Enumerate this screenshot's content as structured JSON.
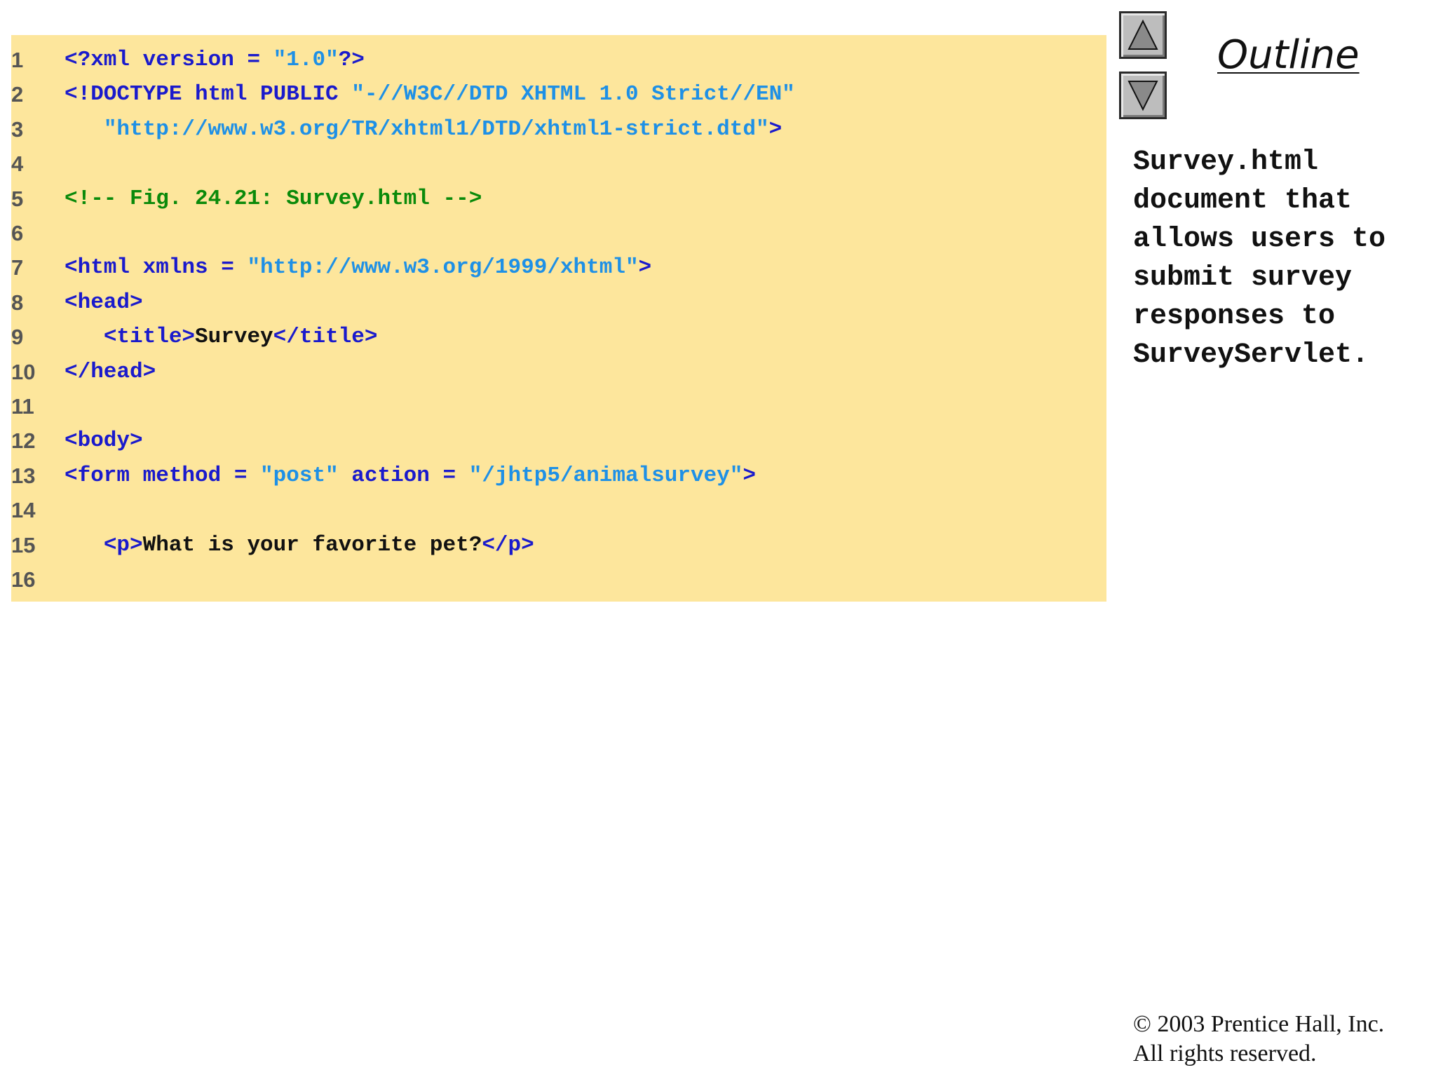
{
  "code_lines": [
    {
      "num": "1",
      "tokens": [
        {
          "t": "<?xml version = ",
          "c": "tag"
        },
        {
          "t": "\"1.0\"",
          "c": "str"
        },
        {
          "t": "?>",
          "c": "tag"
        }
      ]
    },
    {
      "num": "2",
      "tokens": [
        {
          "t": "<!DOCTYPE html PUBLIC ",
          "c": "tag"
        },
        {
          "t": "\"-//W3C//DTD XHTML 1.0 Strict//EN\"",
          "c": "str"
        }
      ]
    },
    {
      "num": "3",
      "tokens": [
        {
          "t": "   ",
          "c": "txt"
        },
        {
          "t": "\"http://www.w3.org/TR/xhtml1/DTD/xhtml1-strict.dtd\"",
          "c": "str"
        },
        {
          "t": ">",
          "c": "tag"
        }
      ]
    },
    {
      "num": "4",
      "tokens": []
    },
    {
      "num": "5",
      "tokens": [
        {
          "t": "<!-- Fig. 24.21: Survey.html -->",
          "c": "cmt"
        }
      ]
    },
    {
      "num": "6",
      "tokens": []
    },
    {
      "num": "7",
      "tokens": [
        {
          "t": "<html xmlns = ",
          "c": "tag"
        },
        {
          "t": "\"http://www.w3.org/1999/xhtml\"",
          "c": "str"
        },
        {
          "t": ">",
          "c": "tag"
        }
      ]
    },
    {
      "num": "8",
      "tokens": [
        {
          "t": "<head>",
          "c": "tag"
        }
      ]
    },
    {
      "num": "9",
      "tokens": [
        {
          "t": "   ",
          "c": "txt"
        },
        {
          "t": "<title>",
          "c": "tag"
        },
        {
          "t": "Survey",
          "c": "txt"
        },
        {
          "t": "</title>",
          "c": "tag"
        }
      ]
    },
    {
      "num": "10",
      "tokens": [
        {
          "t": "</head>",
          "c": "tag"
        }
      ]
    },
    {
      "num": "11",
      "tokens": []
    },
    {
      "num": "12",
      "tokens": [
        {
          "t": "<body>",
          "c": "tag"
        }
      ]
    },
    {
      "num": "13",
      "tokens": [
        {
          "t": "<form method = ",
          "c": "tag"
        },
        {
          "t": "\"post\"",
          "c": "str"
        },
        {
          "t": " action = ",
          "c": "tag"
        },
        {
          "t": "\"/jhtp5/animalsurvey\"",
          "c": "str"
        },
        {
          "t": ">",
          "c": "tag"
        }
      ]
    },
    {
      "num": "14",
      "tokens": []
    },
    {
      "num": "15",
      "tokens": [
        {
          "t": "   ",
          "c": "txt"
        },
        {
          "t": "<p>",
          "c": "tag"
        },
        {
          "t": "What is your favorite pet?",
          "c": "txt"
        },
        {
          "t": "</p>",
          "c": "tag"
        }
      ]
    },
    {
      "num": "16",
      "tokens": []
    }
  ],
  "outline": {
    "title": "Outline"
  },
  "description": {
    "lines": [
      "Survey.html",
      "document that",
      "allows users to",
      "submit survey",
      "responses to",
      "SurveyServlet."
    ]
  },
  "copyright": {
    "line1": "© 2003 Prentice Hall, Inc.",
    "line2": "All rights reserved."
  },
  "icons": {
    "up": "up-arrow-icon",
    "down": "down-arrow-icon"
  },
  "colors": {
    "panel": "#fde69c",
    "tag": "#1a1acc",
    "string": "#1e90e6",
    "comment": "#0a8a0a"
  }
}
